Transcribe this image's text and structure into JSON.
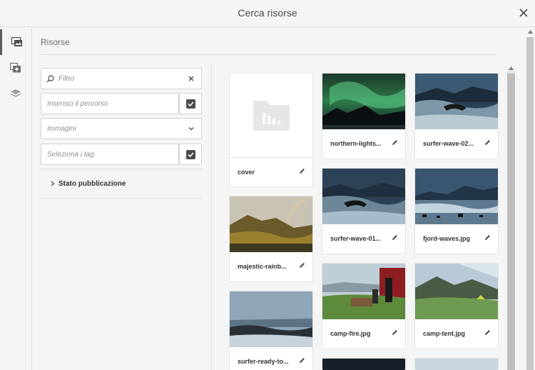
{
  "dialog": {
    "title": "Cerca risorse"
  },
  "rail": [
    {
      "name": "assets-icon",
      "active": true
    },
    {
      "name": "components-icon",
      "active": false
    },
    {
      "name": "layers-icon",
      "active": false
    }
  ],
  "panel": {
    "header": "Risorse"
  },
  "filters": {
    "search_placeholder": "Filtro",
    "path_placeholder": "Inserisci il percorso",
    "type_value": "Immagini",
    "tags_placeholder": "Seleziona i tag",
    "publish_status_label": "Stato pubblicazione"
  },
  "assets": [
    {
      "name": "cover",
      "kind": "folder"
    },
    {
      "name": "northern-lights...",
      "kind": "image",
      "image": "northern-lights"
    },
    {
      "name": "surfer-wave-02...",
      "kind": "image",
      "image": "surfer-wave-02"
    },
    {
      "name": "surfer-wave-01...",
      "kind": "image",
      "image": "surfer-wave-01"
    },
    {
      "name": "fjord-waves.jpg",
      "kind": "image",
      "image": "fjord-waves"
    },
    {
      "name": "majestic-rainb...",
      "kind": "image",
      "image": "majestic-rainbow"
    },
    {
      "name": "camp-fire.jpg",
      "kind": "image",
      "image": "camp-fire"
    },
    {
      "name": "camp-tent.jpg",
      "kind": "image",
      "image": "camp-tent"
    },
    {
      "name": "surfer-ready-to...",
      "kind": "image",
      "image": "surfer-ready"
    }
  ],
  "colors": {
    "accent": "#5c5c5c",
    "panel_bg": "#f5f5f5"
  }
}
